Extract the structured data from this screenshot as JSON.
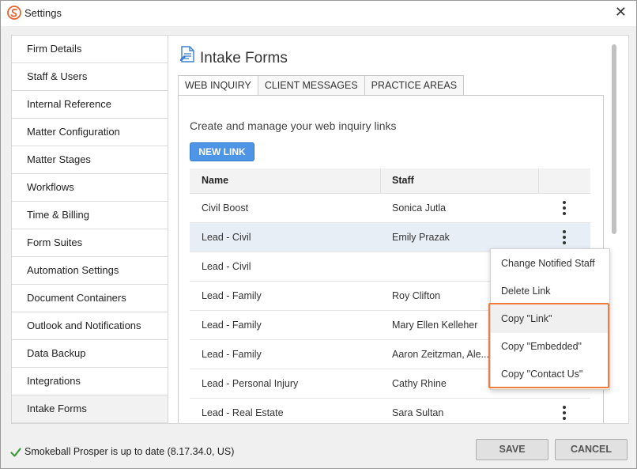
{
  "window": {
    "title": "Settings",
    "close_glyph": "✕"
  },
  "sidebar": {
    "items": [
      {
        "label": "Firm Details"
      },
      {
        "label": "Staff & Users"
      },
      {
        "label": "Internal Reference"
      },
      {
        "label": "Matter Configuration"
      },
      {
        "label": "Matter Stages"
      },
      {
        "label": "Workflows"
      },
      {
        "label": "Time & Billing"
      },
      {
        "label": "Form Suites"
      },
      {
        "label": "Automation Settings"
      },
      {
        "label": "Document Containers"
      },
      {
        "label": "Outlook and Notifications"
      },
      {
        "label": "Data Backup"
      },
      {
        "label": "Integrations"
      },
      {
        "label": "Intake Forms"
      }
    ],
    "active_index": 13
  },
  "main": {
    "title": "Intake Forms",
    "tabs": [
      {
        "label": "WEB INQUIRY"
      },
      {
        "label": "CLIENT MESSAGES"
      },
      {
        "label": "PRACTICE AREAS"
      }
    ],
    "description": "Create and manage your web inquiry links",
    "new_link_label": "NEW LINK",
    "table": {
      "columns": [
        "Name",
        "Staff"
      ],
      "rows": [
        {
          "name": "Civil Boost",
          "staff": "Sonica Jutla"
        },
        {
          "name": "Lead - Civil",
          "staff": "Emily Prazak"
        },
        {
          "name": "Lead - Civil",
          "staff": ""
        },
        {
          "name": "Lead - Family",
          "staff": "Roy Clifton"
        },
        {
          "name": "Lead - Family",
          "staff": "Mary Ellen Kelleher"
        },
        {
          "name": "Lead - Family",
          "staff": "Aaron Zeitzman, Ale..."
        },
        {
          "name": "Lead - Personal Injury",
          "staff": "Cathy Rhine"
        },
        {
          "name": "Lead - Real Estate",
          "staff": "Sara Sultan"
        }
      ]
    }
  },
  "context_menu": {
    "items": [
      {
        "label": "Change Notified Staff"
      },
      {
        "label": "Delete Link"
      },
      {
        "label": "Copy \"Link\""
      },
      {
        "label": "Copy \"Embedded\""
      },
      {
        "label": "Copy \"Contact Us\""
      }
    ]
  },
  "footer": {
    "status": "Smokeball Prosper is up to date (8.17.34.0, US)",
    "save_label": "SAVE",
    "cancel_label": "CANCEL"
  },
  "colors": {
    "accent": "#4f95e5",
    "highlight": "#f07c3c",
    "app_icon": "#e8622c",
    "check": "#3a9a3a",
    "selected_row": "#e8eef5"
  },
  "icons": {
    "app": "smokeball-logo-icon",
    "page": "form-document-icon",
    "row_menu": "kebab-menu-icon",
    "status": "check-icon"
  }
}
